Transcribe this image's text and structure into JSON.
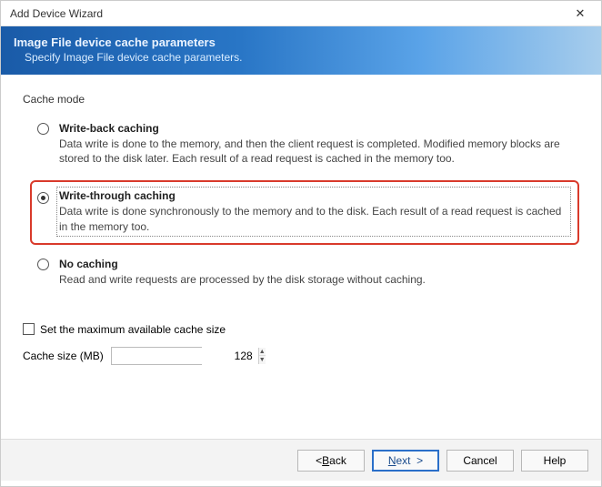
{
  "window": {
    "title": "Add Device Wizard"
  },
  "header": {
    "title": "Image File device cache parameters",
    "subtitle": "Specify Image File device cache parameters."
  },
  "group": {
    "label": "Cache mode"
  },
  "options": [
    {
      "title": "Write-back caching",
      "desc": "Data write is done to the memory, and then the client request is completed. Modified memory blocks are stored to the disk later. Each result of a read request is cached in the memory too.",
      "checked": false
    },
    {
      "title": "Write-through caching",
      "desc": "Data write is done synchronously to the memory and to the disk. Each result of a read request is cached in the memory too.",
      "checked": true
    },
    {
      "title": "No caching",
      "desc": "Read and write requests are processed by the disk storage without caching.",
      "checked": false
    }
  ],
  "checkbox": {
    "label": "Set the maximum available cache size",
    "checked": false
  },
  "cacheSize": {
    "label": "Cache size (MB)",
    "value": "128"
  },
  "buttons": {
    "back": "< Back",
    "next": "Next >",
    "cancel": "Cancel",
    "help": "Help"
  }
}
